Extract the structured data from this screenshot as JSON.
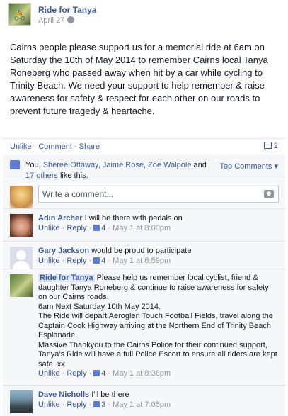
{
  "post": {
    "page_name": "Ride for Tanya",
    "date": "April 27",
    "text": "Cairns people please support us for a memorial ride at 6am on Saturday the 10th of May 2014 to remember Cairns local Tanya Roneberg who passed away when hit by a car while cycling to Trinity Beach. We need your support to help remember & raise awareness for safety & respect for each other on our roads to prevent future tragedy & heartache."
  },
  "actions": {
    "unlike": "Unlike",
    "comment": "Comment",
    "share": "Share",
    "separator": "·",
    "share_count": "2"
  },
  "likes": {
    "prefix": "You,",
    "names": [
      "Sheree Ottaway,",
      "Jaime Rose,",
      "Zoe Walpole"
    ],
    "and": "and",
    "others": "17 others",
    "suffix": "like this.",
    "top_comments": "Top Comments ▾"
  },
  "write_comment": {
    "placeholder": "Write a comment..."
  },
  "comments": [
    {
      "author": "Adin Archer",
      "text": "I will be there with pedals on",
      "unlike": "Unlike",
      "reply": "Reply",
      "likes": "4",
      "time": "May 1 at 8:00pm"
    },
    {
      "author": "Gary Jackson",
      "text": "would be proud to participate",
      "unlike": "Unlike",
      "reply": "Reply",
      "likes": "4",
      "time": "May 1 at 6:59pm"
    },
    {
      "author": "Ride for Tanya",
      "text_lines": [
        "Please help us remember local cyclist, friend & daughter Tanya Roneberg & continue to raise awareness for safety on our Cairns roads.",
        "6am Next Saturday 10th May 2014.",
        "The Ride will depart Aeroglen Touch Football Fields, travel along the Captain Cook Highway arriving at the Northern End of Trinity Beach Esplanade.",
        "Massive Thankyou to the Cairns Police for their continued support, Tanya's Ride will have a full Police Escort to ensure all riders are kept safe. xx"
      ],
      "unlike": "Unlike",
      "reply": "Reply",
      "likes": "4",
      "time": "May 1 at 8:38pm"
    },
    {
      "author": "Dave Nicholls",
      "text": "I'll be there",
      "unlike": "Unlike",
      "reply": "Reply",
      "likes": "3",
      "time": "May 1 at 7:05pm"
    }
  ],
  "colors": {
    "link": "#3b5998",
    "meta": "#90949c",
    "ufi_bg": "#f6f7f9"
  }
}
